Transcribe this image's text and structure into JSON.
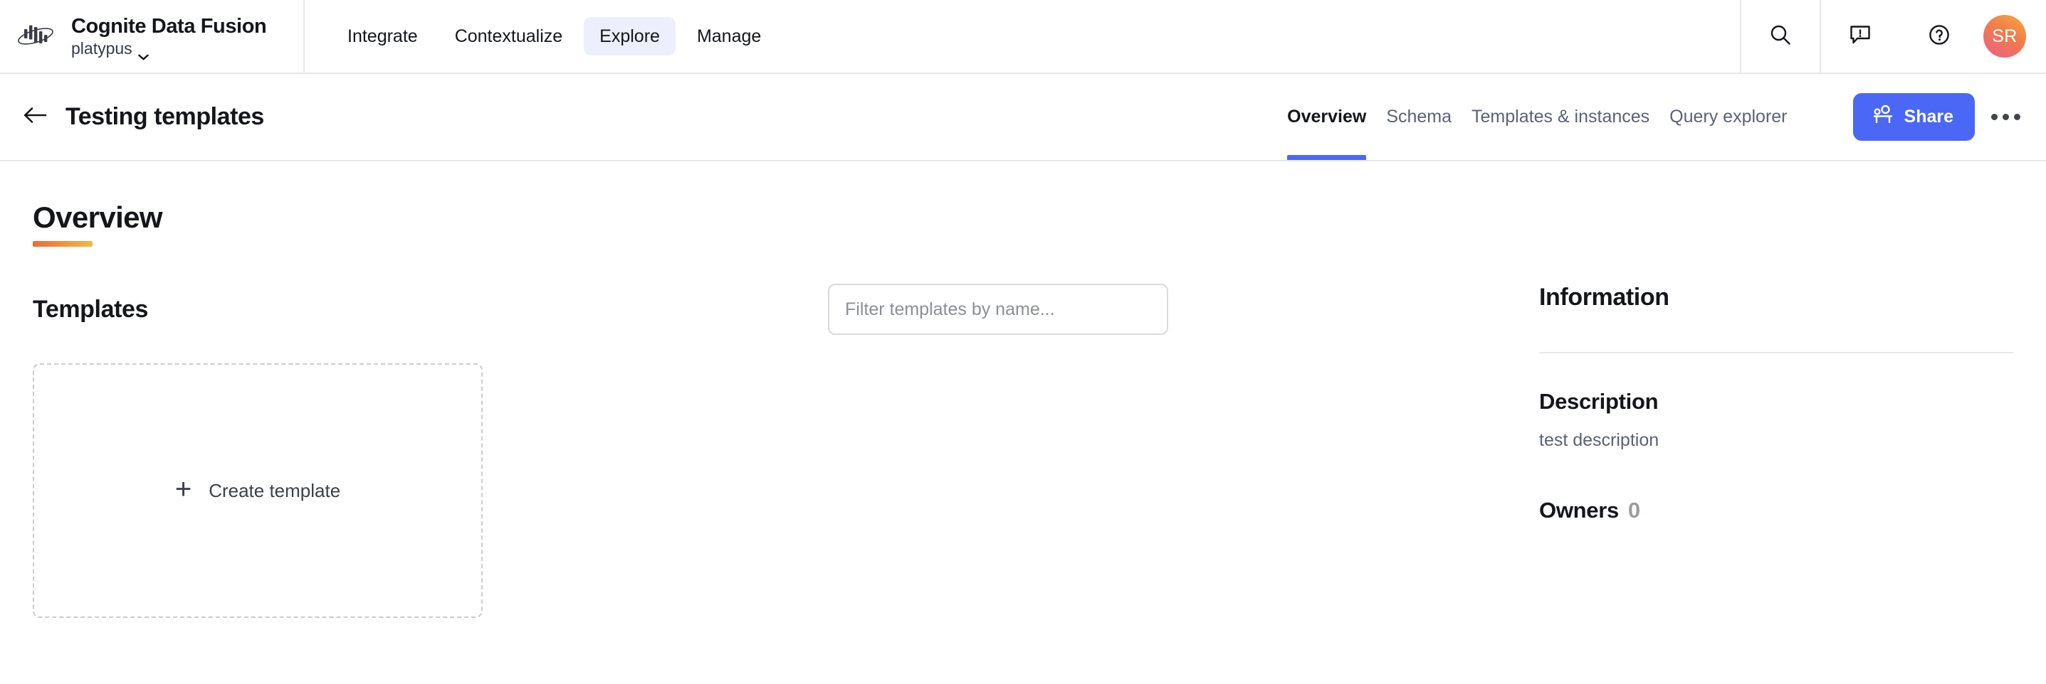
{
  "topbar": {
    "brand_title": "Cognite Data Fusion",
    "project": "platypus",
    "logo_icon": "cognite-logo-icon",
    "project_chevron_icon": "chevron-down-icon",
    "nav": [
      {
        "label": "Integrate",
        "active": false
      },
      {
        "label": "Contextualize",
        "active": false
      },
      {
        "label": "Explore",
        "active": true
      },
      {
        "label": "Manage",
        "active": false
      }
    ],
    "actions": [
      {
        "name": "search-icon",
        "title": "Search"
      },
      {
        "name": "feedback-icon",
        "title": "Feedback"
      },
      {
        "name": "help-icon",
        "title": "Help"
      }
    ],
    "avatar_initials": "SR"
  },
  "subheader": {
    "back_icon": "arrow-left-icon",
    "page_title": "Testing templates",
    "tabs": [
      {
        "label": "Overview",
        "active": true
      },
      {
        "label": "Schema",
        "active": false
      },
      {
        "label": "Templates & instances",
        "active": false
      },
      {
        "label": "Query explorer",
        "active": false
      }
    ],
    "share_label": "Share",
    "share_icon": "people-icon",
    "more_icon": "ellipsis-icon"
  },
  "main": {
    "overview_heading": "Overview",
    "templates_heading": "Templates",
    "filter_placeholder": "Filter templates by name...",
    "filter_value": "",
    "create_card": {
      "plus_icon": "plus-icon",
      "label": "Create template"
    }
  },
  "information": {
    "heading": "Information",
    "description_heading": "Description",
    "description_text": "test description",
    "owners_label": "Owners",
    "owners_count": "0"
  },
  "colors": {
    "accent_blue": "#4a67f5",
    "nav_active_bg": "#edeffc",
    "underline_gradient_start": "#ec6b34",
    "underline_gradient_end": "#f2b848",
    "border": "#e8e8ea",
    "muted_text": "#5b6272"
  }
}
